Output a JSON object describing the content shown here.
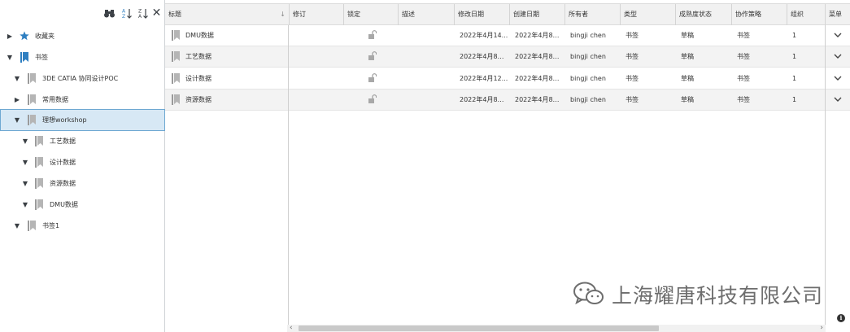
{
  "tree": {
    "toolbar": {
      "binoculars_icon": "binoculars-icon",
      "sort_az_label": "A Z",
      "sort_za_label": "Z A",
      "close_glyph": "✕"
    },
    "nodes": [
      {
        "label": "收藏夹",
        "expanded": false,
        "icon": "star-icon"
      },
      {
        "label": "书签",
        "expanded": true,
        "icon": "bookmark-blue-icon"
      },
      {
        "label": "3DE CATIA 协同设计POC",
        "expanded": true,
        "icon": "bookmark-icon"
      },
      {
        "label": "常用数据",
        "expanded": false,
        "icon": "bookmark-icon"
      },
      {
        "label": "理想workshop",
        "expanded": true,
        "icon": "bookmark-icon",
        "selected": true
      },
      {
        "label": "工艺数据",
        "expanded": true,
        "icon": "bookmark-icon"
      },
      {
        "label": "设计数据",
        "expanded": true,
        "icon": "bookmark-icon"
      },
      {
        "label": "资源数据",
        "expanded": true,
        "icon": "bookmark-icon"
      },
      {
        "label": "DMU数据",
        "expanded": true,
        "icon": "bookmark-icon"
      },
      {
        "label": "书签1",
        "expanded": true,
        "icon": "bookmark-icon"
      }
    ]
  },
  "grid": {
    "headers": [
      "标题",
      "修订",
      "锁定",
      "描述",
      "修改日期",
      "创建日期",
      "所有者",
      "类型",
      "成熟度状态",
      "协作策略",
      "组织",
      "菜单"
    ],
    "rows": [
      {
        "title": "DMU数据",
        "revision": "",
        "lock": "unlock-icon",
        "description": "",
        "modified": "2022年4月14...",
        "created": "2022年4月8日 ...",
        "owner": "bingji chen",
        "type": "书签",
        "maturity": "草稿",
        "policy": "书签",
        "org": "1",
        "menu": "chevron-down-icon"
      },
      {
        "title": "工艺数据",
        "revision": "",
        "lock": "unlock-icon",
        "description": "",
        "modified": "2022年4月8日 ...",
        "created": "2022年4月8日 ...",
        "owner": "bingji chen",
        "type": "书签",
        "maturity": "草稿",
        "policy": "书签",
        "org": "1",
        "menu": "chevron-down-icon"
      },
      {
        "title": "设计数据",
        "revision": "",
        "lock": "unlock-icon",
        "description": "",
        "modified": "2022年4月12...",
        "created": "2022年4月8日 ...",
        "owner": "bingji chen",
        "type": "书签",
        "maturity": "草稿",
        "policy": "书签",
        "org": "1",
        "menu": "chevron-down-icon"
      },
      {
        "title": "资源数据",
        "revision": "",
        "lock": "unlock-icon",
        "description": "",
        "modified": "2022年4月8日 ...",
        "created": "2022年4月8日 ...",
        "owner": "bingji chen",
        "type": "书签",
        "maturity": "草稿",
        "policy": "书签",
        "org": "1",
        "menu": "chevron-down-icon"
      }
    ],
    "scroll_left": "‹",
    "scroll_right": "›"
  },
  "watermark": {
    "text": "上海耀唐科技有限公司",
    "icon": "wechat-icon"
  },
  "info_glyph": "i",
  "colors": {
    "accent": "#2f7fc1",
    "selected_bg": "#d7e8f5",
    "header_bg": "#f1f1f1"
  }
}
